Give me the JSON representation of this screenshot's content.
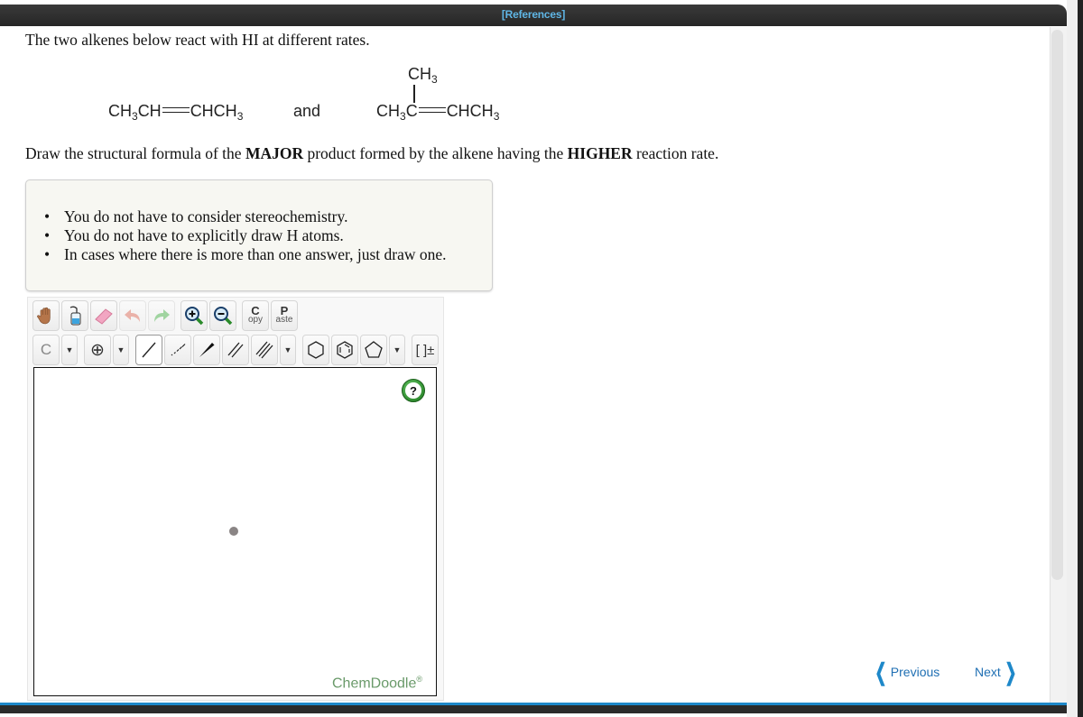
{
  "header": {
    "references_label": "[References]"
  },
  "intro_text": "The two alkenes below react with HI at different rates.",
  "molecules": {
    "first": {
      "parts": [
        "CH",
        "3",
        "CH",
        "CHCH",
        "3"
      ]
    },
    "and_label": "and",
    "second": {
      "top": [
        "CH",
        "3"
      ],
      "parts": [
        "CH",
        "3",
        "C",
        "CHCH",
        "3"
      ]
    }
  },
  "question": {
    "pre": "Draw the structural formula of the ",
    "bold1": "MAJOR",
    "mid": " product formed by the alkene having the ",
    "bold2": "HIGHER",
    "post": " reaction rate."
  },
  "hints": [
    "You do not have to consider stereochemistry.",
    "You do not have to explicitly draw H atoms.",
    "In cases where there is more than one answer, just draw one."
  ],
  "toolbar": {
    "row1": [
      {
        "name": "hand-pan-icon"
      },
      {
        "name": "clear-bottle-icon"
      },
      {
        "name": "eraser-icon"
      },
      {
        "name": "undo-icon"
      },
      {
        "name": "redo-icon"
      },
      {
        "name": "zoom-in-icon"
      },
      {
        "name": "zoom-out-icon"
      }
    ],
    "copy": {
      "big": "C",
      "small": "opy"
    },
    "paste": {
      "big": "P",
      "small": "aste"
    },
    "atom_label": "C",
    "charge_label": "⊕",
    "bracket_label": "[ ]±"
  },
  "help_label": "?",
  "brand": {
    "name": "ChemDoodle",
    "mark": "®"
  },
  "nav": {
    "previous": "Previous",
    "next": "Next"
  },
  "colors": {
    "accent": "#1e88c9",
    "link": "#5fb6e6",
    "brand": "#6a9a6a"
  }
}
